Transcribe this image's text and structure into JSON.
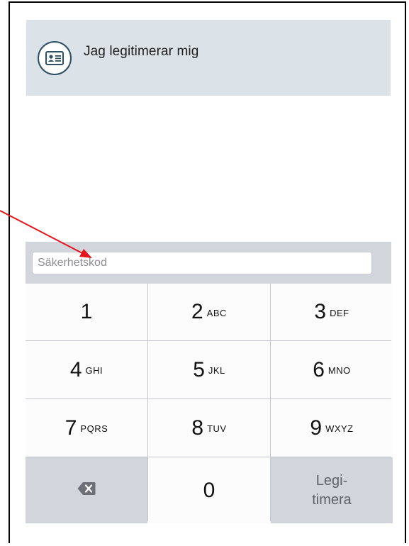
{
  "banner": {
    "title": "Jag legitimerar mig",
    "icon": "id-card-icon"
  },
  "keyboard": {
    "input_placeholder": "Säkerhetskod",
    "input_value": "",
    "keys": [
      {
        "digit": "1",
        "letters": ""
      },
      {
        "digit": "2",
        "letters": "ABC"
      },
      {
        "digit": "3",
        "letters": "DEF"
      },
      {
        "digit": "4",
        "letters": "GHI"
      },
      {
        "digit": "5",
        "letters": "JKL"
      },
      {
        "digit": "6",
        "letters": "MNO"
      },
      {
        "digit": "7",
        "letters": "PQRS"
      },
      {
        "digit": "8",
        "letters": "TUV"
      },
      {
        "digit": "9",
        "letters": "WXYZ"
      }
    ],
    "backspace_icon": "backspace-icon",
    "zero": "0",
    "action_line1": "Legi-",
    "action_line2": "timera"
  },
  "colors": {
    "banner_bg": "#dbe2e8",
    "arrow": "#e8141c",
    "keyboard_bg": "#d2d5db"
  }
}
